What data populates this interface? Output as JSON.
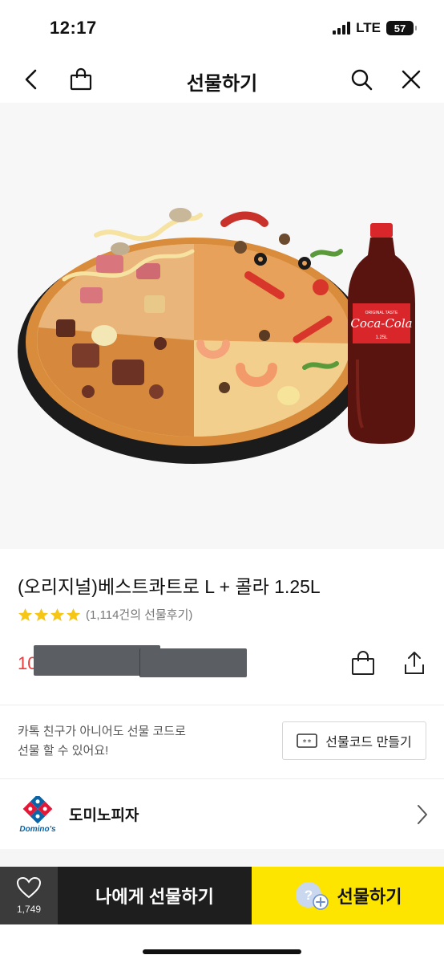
{
  "status": {
    "time": "12:17",
    "network": "LTE",
    "battery": "57"
  },
  "nav": {
    "title": "선물하기",
    "back_icon": "chevron-left-icon",
    "bag_icon": "shopping-bag-icon",
    "search_icon": "search-icon",
    "close_icon": "close-icon"
  },
  "hero": {
    "image_alt": "",
    "bottle_brand": "Coca-Cola",
    "bottle_tagline": "ORIGINAL TASTE",
    "bottle_volume": "1.25L"
  },
  "product": {
    "title": "(오리지널)베스트콰트로 L + 콜라 1.25L",
    "rating_stars": 4,
    "rating_max": 5,
    "review_text": "(1,114건의 선물후기)",
    "price_visible": "10"
  },
  "gift_code": {
    "info_line1": "카톡 친구가 아니어도 선물 코드로",
    "info_line2": "선물 할 수 있어요!",
    "button_label": "선물코드 만들기"
  },
  "brand": {
    "name": "도미노피자",
    "logo_text": "Domino's"
  },
  "bottom": {
    "like_count": "1,749",
    "self_gift_label": "나에게 선물하기",
    "gift_label": "선물하기"
  },
  "colors": {
    "accent_yellow": "#fee500",
    "price_red": "#ee3c3c",
    "dark_button": "#1e1e1e",
    "star": "#f5c518"
  }
}
